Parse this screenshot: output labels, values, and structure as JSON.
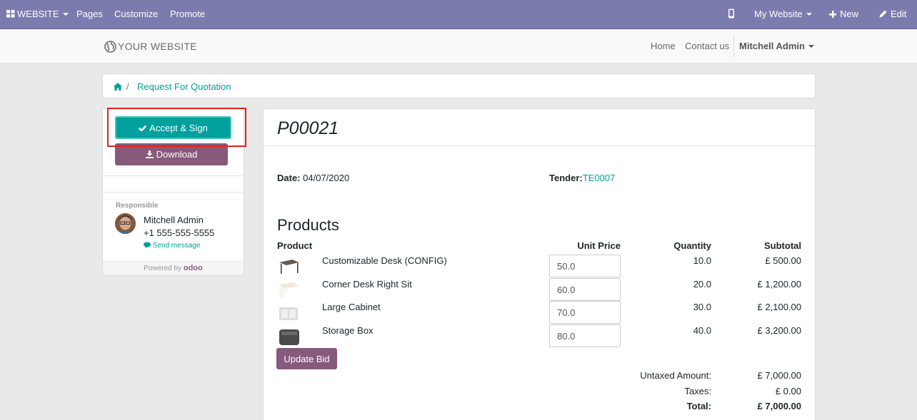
{
  "topbar": {
    "website_label": "WEBSITE",
    "pages": "Pages",
    "customize": "Customize",
    "promote": "Promote",
    "my_website": "My Website",
    "new": "New",
    "edit": "Edit"
  },
  "header": {
    "logo_text": "YOUR WEBSITE",
    "nav": [
      "Home",
      "Contact us"
    ],
    "user": "Mitchell Admin"
  },
  "breadcrumb": {
    "current": "Request For Quotation"
  },
  "sidebar": {
    "accept_label": "Accept & Sign",
    "download_label": "Download",
    "responsible_label": "Responsible",
    "responsible_name": "Mitchell Admin",
    "responsible_phone": "+1 555-555-5555",
    "send_message": "Send message",
    "powered_by": "Powered by",
    "powered_brand": "odoo"
  },
  "document": {
    "title": "P00021",
    "date_label": "Date:",
    "date_value": "04/07/2020",
    "tender_label": "Tender:",
    "tender_value": "TE0007",
    "section_title": "Products",
    "columns": {
      "product": "Product",
      "unit_price": "Unit Price",
      "quantity": "Quantity",
      "subtotal": "Subtotal"
    },
    "lines": [
      {
        "name": "Customizable Desk (CONFIG)",
        "price": "50.0",
        "qty": "10.0",
        "subtotal": "£ 500.00"
      },
      {
        "name": "Corner Desk Right Sit",
        "price": "60.0",
        "qty": "20.0",
        "subtotal": "£ 1,200.00"
      },
      {
        "name": "Large Cabinet",
        "price": "70.0",
        "qty": "30.0",
        "subtotal": "£ 2,100.00"
      },
      {
        "name": "Storage Box",
        "price": "80.0",
        "qty": "40.0",
        "subtotal": "£ 3,200.00"
      }
    ],
    "update_bid": "Update Bid",
    "totals": {
      "untaxed_label": "Untaxed Amount:",
      "untaxed_value": "£ 7,000.00",
      "taxes_label": "Taxes:",
      "taxes_value": "£ 0.00",
      "total_label": "Total:",
      "total_value": "£ 7,000.00"
    }
  },
  "colors": {
    "topbar": "#7c7bad",
    "primary": "#00a09d",
    "secondary": "#875a7b",
    "highlight": "#e2231a"
  }
}
